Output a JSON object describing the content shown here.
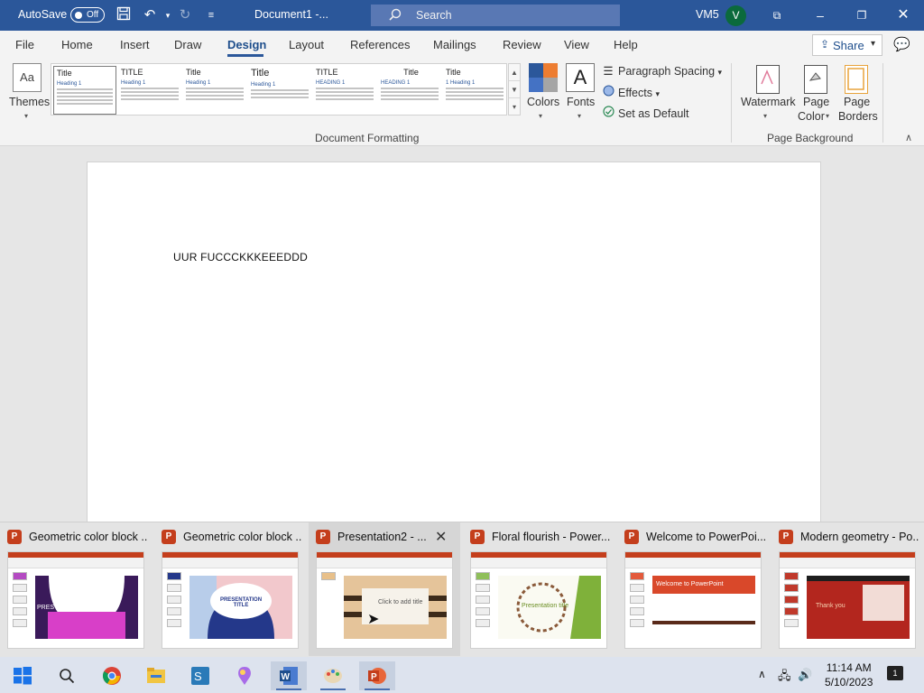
{
  "titlebar": {
    "autosave_label": "AutoSave",
    "autosave_state": "Off",
    "document_title": "Document1 -...",
    "search_placeholder": "Search",
    "user_name": "VM5",
    "user_initial": "V"
  },
  "menu": {
    "tabs": [
      "File",
      "Home",
      "Insert",
      "Draw",
      "Design",
      "Layout",
      "References",
      "Mailings",
      "Review",
      "View",
      "Help"
    ],
    "active_tab": "Design",
    "share_label": "Share"
  },
  "ribbon": {
    "themes_label": "Themes",
    "style_set": [
      {
        "title": "Title",
        "heading": "Heading 1"
      },
      {
        "title": "TITLE",
        "heading": "Heading 1"
      },
      {
        "title": "Title",
        "heading": "Heading 1"
      },
      {
        "title": "Title",
        "heading": "Heading 1"
      },
      {
        "title": "TITLE",
        "heading": "HEADING 1"
      },
      {
        "title": "Title",
        "heading": "HEADING 1"
      },
      {
        "title": "Title",
        "heading": "1 Heading 1"
      }
    ],
    "colors_label": "Colors",
    "fonts_label": "Fonts",
    "paragraph_spacing_label": "Paragraph Spacing",
    "effects_label": "Effects",
    "set_as_default_label": "Set as Default",
    "document_formatting_label": "Document Formatting",
    "watermark_label": "Watermark",
    "page_color_label_1": "Page",
    "page_color_label_2": "Color",
    "page_borders_label_1": "Page",
    "page_borders_label_2": "Borders",
    "page_background_label": "Page Background"
  },
  "document": {
    "body_text": "UUR FUCCCKKKEEEDDD"
  },
  "thumbnails": [
    {
      "title": "Geometric color block ...",
      "slide_text": "PRES"
    },
    {
      "title": "Geometric color block ...",
      "slide_text": "PRESENTATION TITLE"
    },
    {
      "title": "Presentation2 - ...",
      "slide_text": "Click to add title"
    },
    {
      "title": "Floral flourish - Power...",
      "slide_text": "Presentation title"
    },
    {
      "title": "Welcome to PowerPoi...",
      "slide_text": "Welcome to PowerPoint"
    },
    {
      "title": "Modern geometry - Po...",
      "slide_text": "Thank you"
    }
  ],
  "taskbar": {
    "time": "11:14 AM",
    "date": "5/10/2023",
    "notification_count": "1"
  },
  "colors": {
    "word_blue": "#2b579a",
    "powerpoint_orange": "#c43e1c"
  }
}
